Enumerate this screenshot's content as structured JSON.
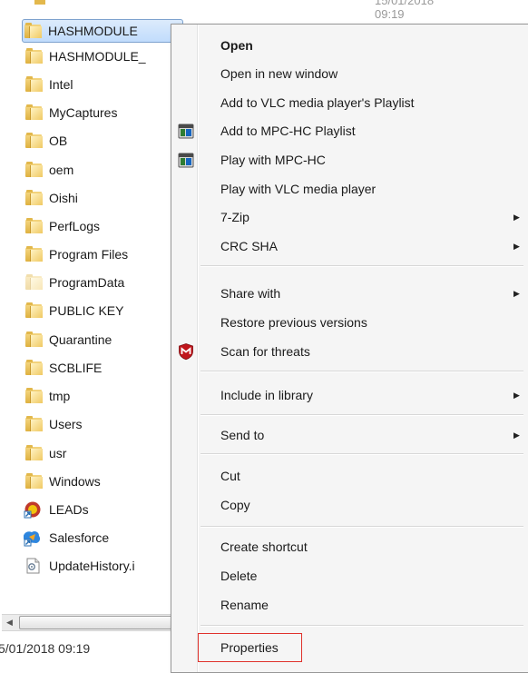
{
  "explorer": {
    "header_date": "15/01/2018 09:19",
    "files": [
      {
        "name": "HASHMODULE",
        "icon": "folder-icon",
        "selected": true
      },
      {
        "name": "HASHMODULE_",
        "icon": "folder-icon"
      },
      {
        "name": "Intel",
        "icon": "folder-icon"
      },
      {
        "name": "MyCaptures",
        "icon": "folder-icon"
      },
      {
        "name": "OB",
        "icon": "folder-icon"
      },
      {
        "name": "oem",
        "icon": "folder-icon"
      },
      {
        "name": "Oishi",
        "icon": "folder-icon"
      },
      {
        "name": "PerfLogs",
        "icon": "folder-icon"
      },
      {
        "name": "Program Files",
        "icon": "folder-icon"
      },
      {
        "name": "ProgramData",
        "icon": "folder-icon",
        "faded": true
      },
      {
        "name": "PUBLIC KEY",
        "icon": "folder-icon"
      },
      {
        "name": "Quarantine",
        "icon": "folder-icon"
      },
      {
        "name": "SCBLIFE",
        "icon": "folder-icon"
      },
      {
        "name": "tmp",
        "icon": "folder-icon"
      },
      {
        "name": "Users",
        "icon": "folder-icon"
      },
      {
        "name": "usr",
        "icon": "folder-icon"
      },
      {
        "name": "Windows",
        "icon": "folder-icon"
      },
      {
        "name": "LEADs",
        "icon": "shortcut-app-icon"
      },
      {
        "name": "Salesforce",
        "icon": "shortcut-app-icon"
      },
      {
        "name": "UpdateHistory.i",
        "icon": "file-icon"
      }
    ],
    "status_date": "5/01/2018 09:19"
  },
  "context_menu": {
    "items": [
      {
        "label": "Open",
        "bold": true
      },
      {
        "label": "Open in new window"
      },
      {
        "label": "Add to VLC media player's Playlist"
      },
      {
        "label": "Add to MPC-HC Playlist",
        "icon": "mpc-hc-icon"
      },
      {
        "label": "Play with MPC-HC",
        "icon": "mpc-hc-icon"
      },
      {
        "label": "Play with VLC media player"
      },
      {
        "label": "7-Zip",
        "submenu": true
      },
      {
        "label": "CRC SHA",
        "submenu": true
      },
      {
        "label": "Share with",
        "submenu": true
      },
      {
        "label": "Restore previous versions"
      },
      {
        "label": "Scan for threats",
        "icon": "mcafee-icon"
      },
      {
        "label": "Include in library",
        "submenu": true
      },
      {
        "label": "Send to",
        "submenu": true
      },
      {
        "label": "Cut"
      },
      {
        "label": "Copy"
      },
      {
        "label": "Create shortcut"
      },
      {
        "label": "Delete"
      },
      {
        "label": "Rename"
      },
      {
        "label": "Properties",
        "highlighted": true
      }
    ]
  },
  "colors": {
    "selection": "#c1dcfc",
    "highlight_border": "#e0322c",
    "menu_background": "#f5f5f5"
  }
}
